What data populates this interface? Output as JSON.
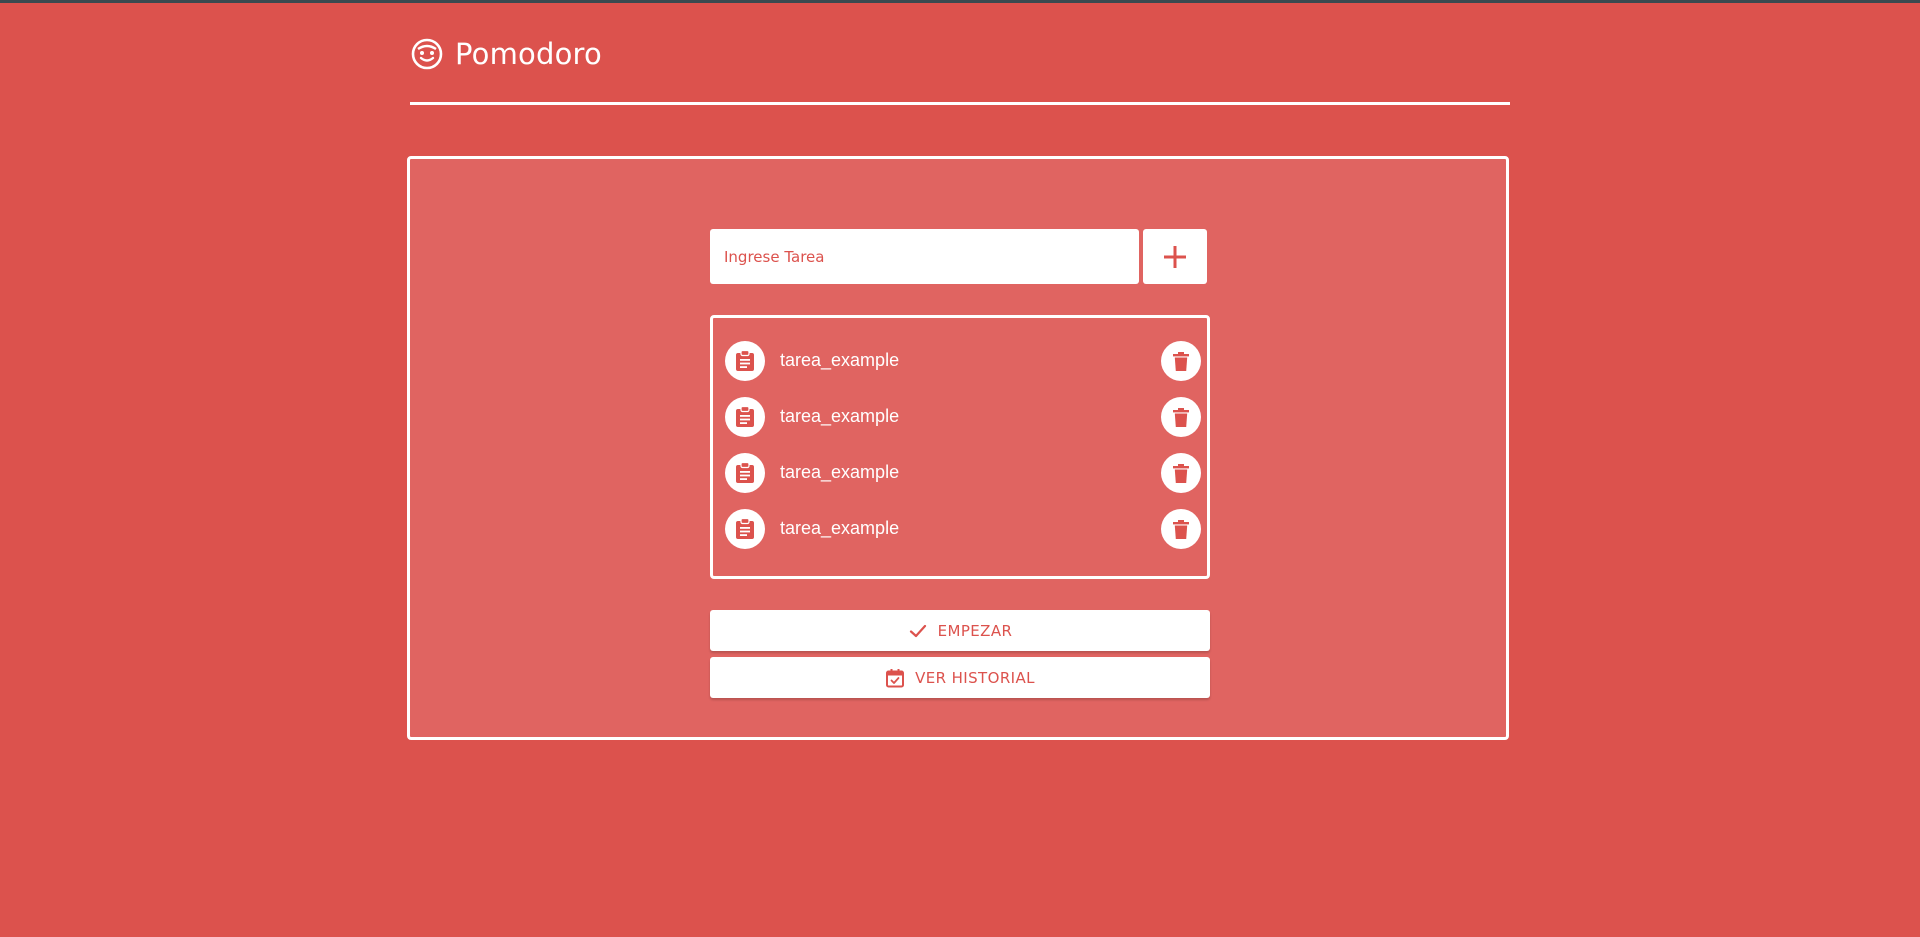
{
  "header": {
    "title": "Pomodoro",
    "logo_icon": "baby-face-icon"
  },
  "form": {
    "placeholder": "Ingrese Tarea",
    "value": "",
    "add_icon": "plus-icon"
  },
  "tasks": [
    {
      "label": "tarea_example",
      "icon": "clipboard-icon",
      "delete_icon": "trash-icon"
    },
    {
      "label": "tarea_example",
      "icon": "clipboard-icon",
      "delete_icon": "trash-icon"
    },
    {
      "label": "tarea_example",
      "icon": "clipboard-icon",
      "delete_icon": "trash-icon"
    },
    {
      "label": "tarea_example",
      "icon": "clipboard-icon",
      "delete_icon": "trash-icon"
    }
  ],
  "actions": {
    "start_label": "EMPEZAR",
    "start_icon": "check-icon",
    "history_label": "VER HISTORIAL",
    "history_icon": "calendar-check-icon"
  },
  "colors": {
    "background": "#dc524d",
    "panel": "#e06461",
    "foreground": "#ffffff",
    "accent": "#dc524d"
  }
}
